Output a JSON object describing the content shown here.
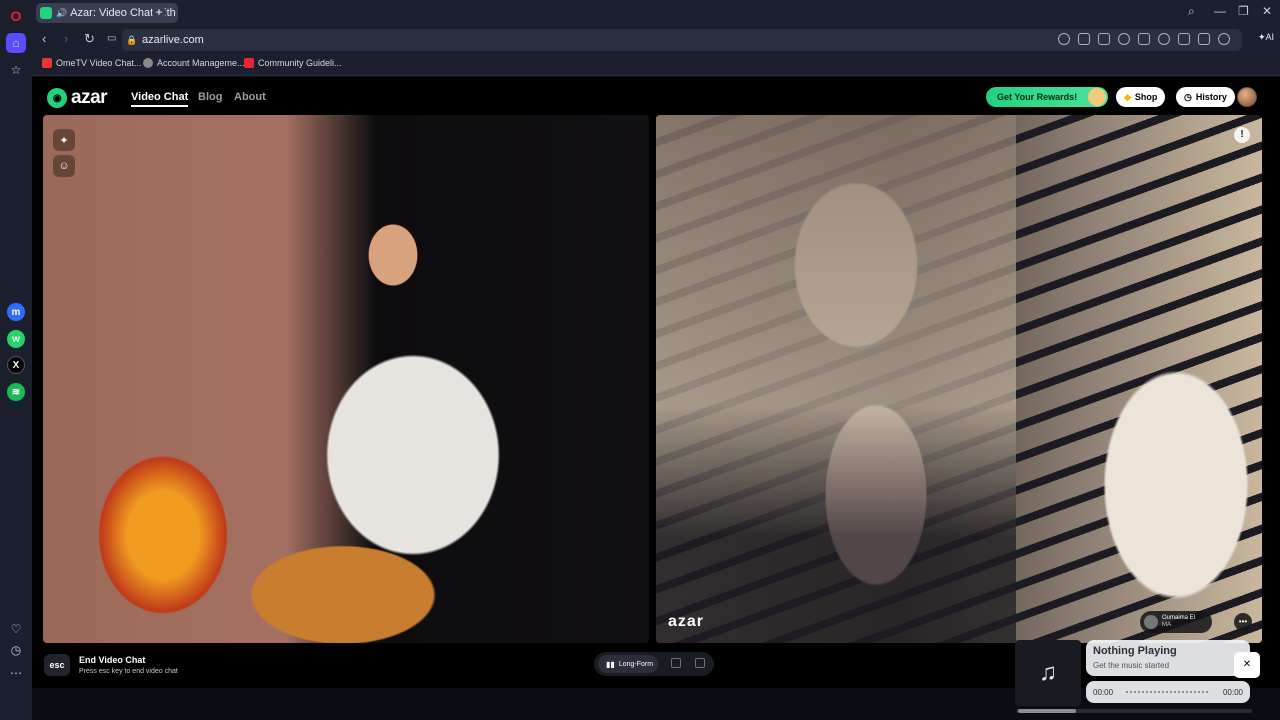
{
  "browser": {
    "tab": {
      "title": "Azar: Video Chat with"
    },
    "url": "azarlive.com",
    "bookmarks": [
      "OmeTV Video Chat...",
      "Account Manageme...",
      "Community Guideli..."
    ]
  },
  "header": {
    "logo_text": "azar",
    "nav": [
      "Video Chat",
      "Blog",
      "About"
    ],
    "rewards_label": "Get Your Rewards!",
    "shop_label": "Shop",
    "history_label": "History"
  },
  "video": {
    "watermark": "azar",
    "peer_name": "Oumaima El",
    "peer_country": "MA"
  },
  "footer": {
    "esc_key": "esc",
    "end_title": "End Video Chat",
    "end_hint": "Press esc key to end video chat",
    "layout_label": "Long-Form"
  },
  "music": {
    "title": "Nothing Playing",
    "subtitle": "Get the music started",
    "time_start": "00:00",
    "time_end": "00:00"
  },
  "colors": {
    "brand": "#22d37a",
    "accent": "#4de29a",
    "chrome": "#1c1f2e"
  }
}
